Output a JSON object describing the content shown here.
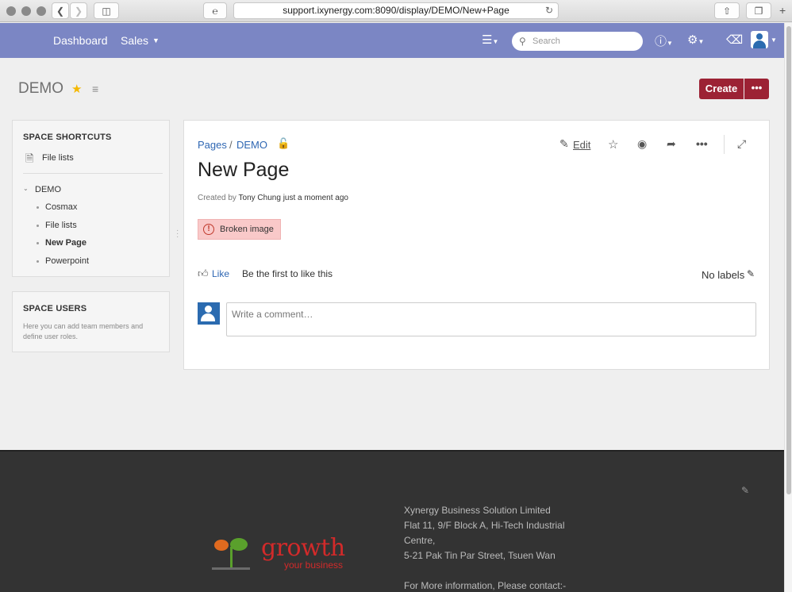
{
  "browser": {
    "url": "support.ixynergy.com:8090/display/DEMO/New+Page"
  },
  "header": {
    "nav": [
      {
        "label": "Dashboard"
      },
      {
        "label": "Sales"
      }
    ],
    "search_placeholder": "Search"
  },
  "space": {
    "title": "DEMO",
    "create_label": "Create"
  },
  "sidebar": {
    "shortcuts_title": "SPACE SHORTCUTS",
    "shortcut_item": "File lists",
    "tree_root": "DEMO",
    "tree_items": [
      "Cosmax",
      "File lists",
      "New Page",
      "Powerpoint"
    ],
    "users_title": "SPACE USERS",
    "users_text": "Here you can add team members and define user roles."
  },
  "page": {
    "breadcrumb": [
      "Pages",
      "DEMO"
    ],
    "edit_label": "Edit",
    "title": "New Page",
    "byline_prefix": "Created by",
    "author": "Tony Chung",
    "byline_suffix": "just a moment ago",
    "broken_image": "Broken image",
    "like_label": "Like",
    "like_text": "Be the first to like this",
    "labels_text": "No labels",
    "comment_placeholder": "Write a comment…"
  },
  "footer": {
    "address_lines": [
      "Xynergy Business Solution Limited",
      "Flat 11, 9/F Block A, Hi-Tech Industrial Centre,",
      "5-21 Pak Tin Par Street, Tsuen Wan",
      "",
      "For More information, Please contact:-"
    ],
    "logo_word": "growth",
    "logo_sub": "your business"
  }
}
